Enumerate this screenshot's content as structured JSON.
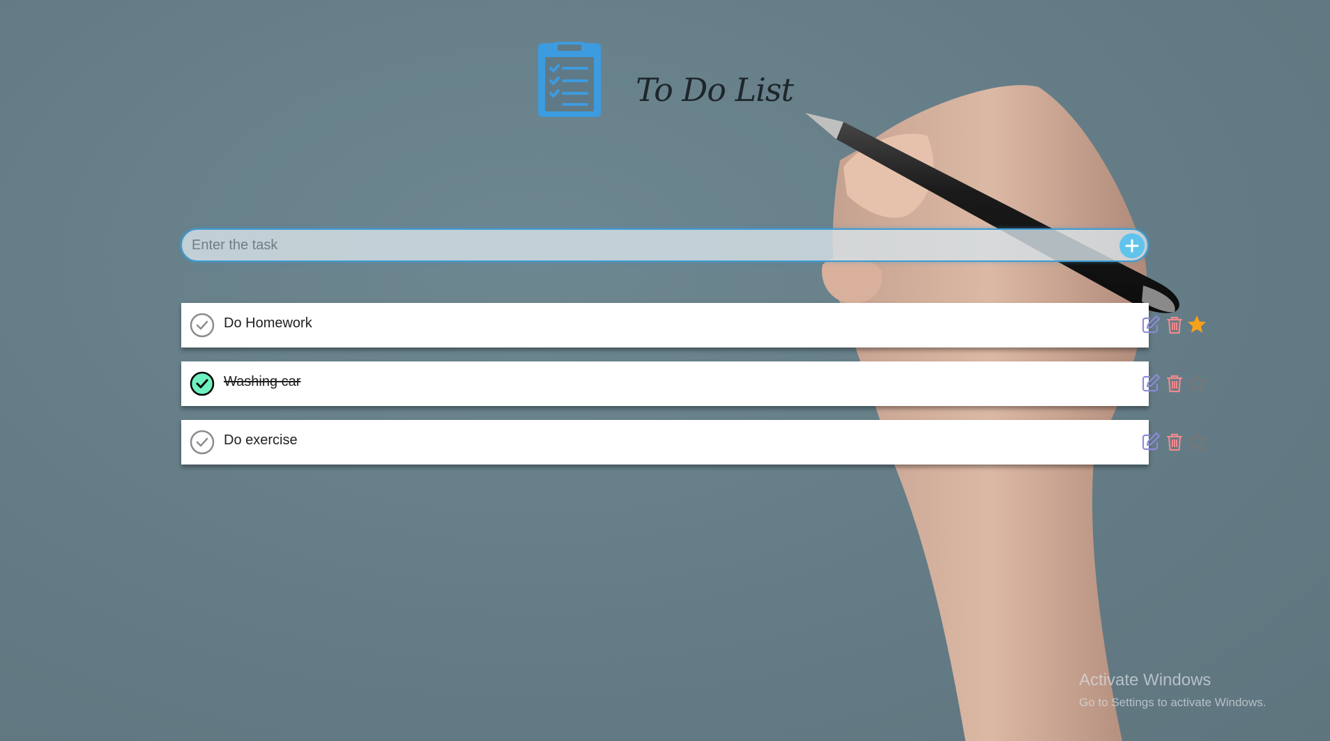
{
  "app": {
    "title": "To Do List"
  },
  "input": {
    "placeholder": "Enter the task",
    "value": "",
    "add_button_label": "+"
  },
  "tasks": [
    {
      "text": "Do Homework",
      "completed": false,
      "starred": true
    },
    {
      "text": "Washing car",
      "completed": true,
      "starred": false
    },
    {
      "text": "Do exercise",
      "completed": false,
      "starred": false
    }
  ],
  "task_actions": [
    "pencil-square-icon",
    "trash-icon",
    "star-icon"
  ],
  "watermark": {
    "title": "Activate Windows",
    "subtitle": "Go to Settings to activate Windows."
  },
  "colors": {
    "accent": "#3f9bd1",
    "add_button": "#5fc3ec",
    "logo": "#3d9be0",
    "completed_check": "#6ef0bf",
    "star_active": "#f7a11a",
    "edit_icon": "#8f8ad8",
    "delete_icon": "#f08a8e"
  }
}
